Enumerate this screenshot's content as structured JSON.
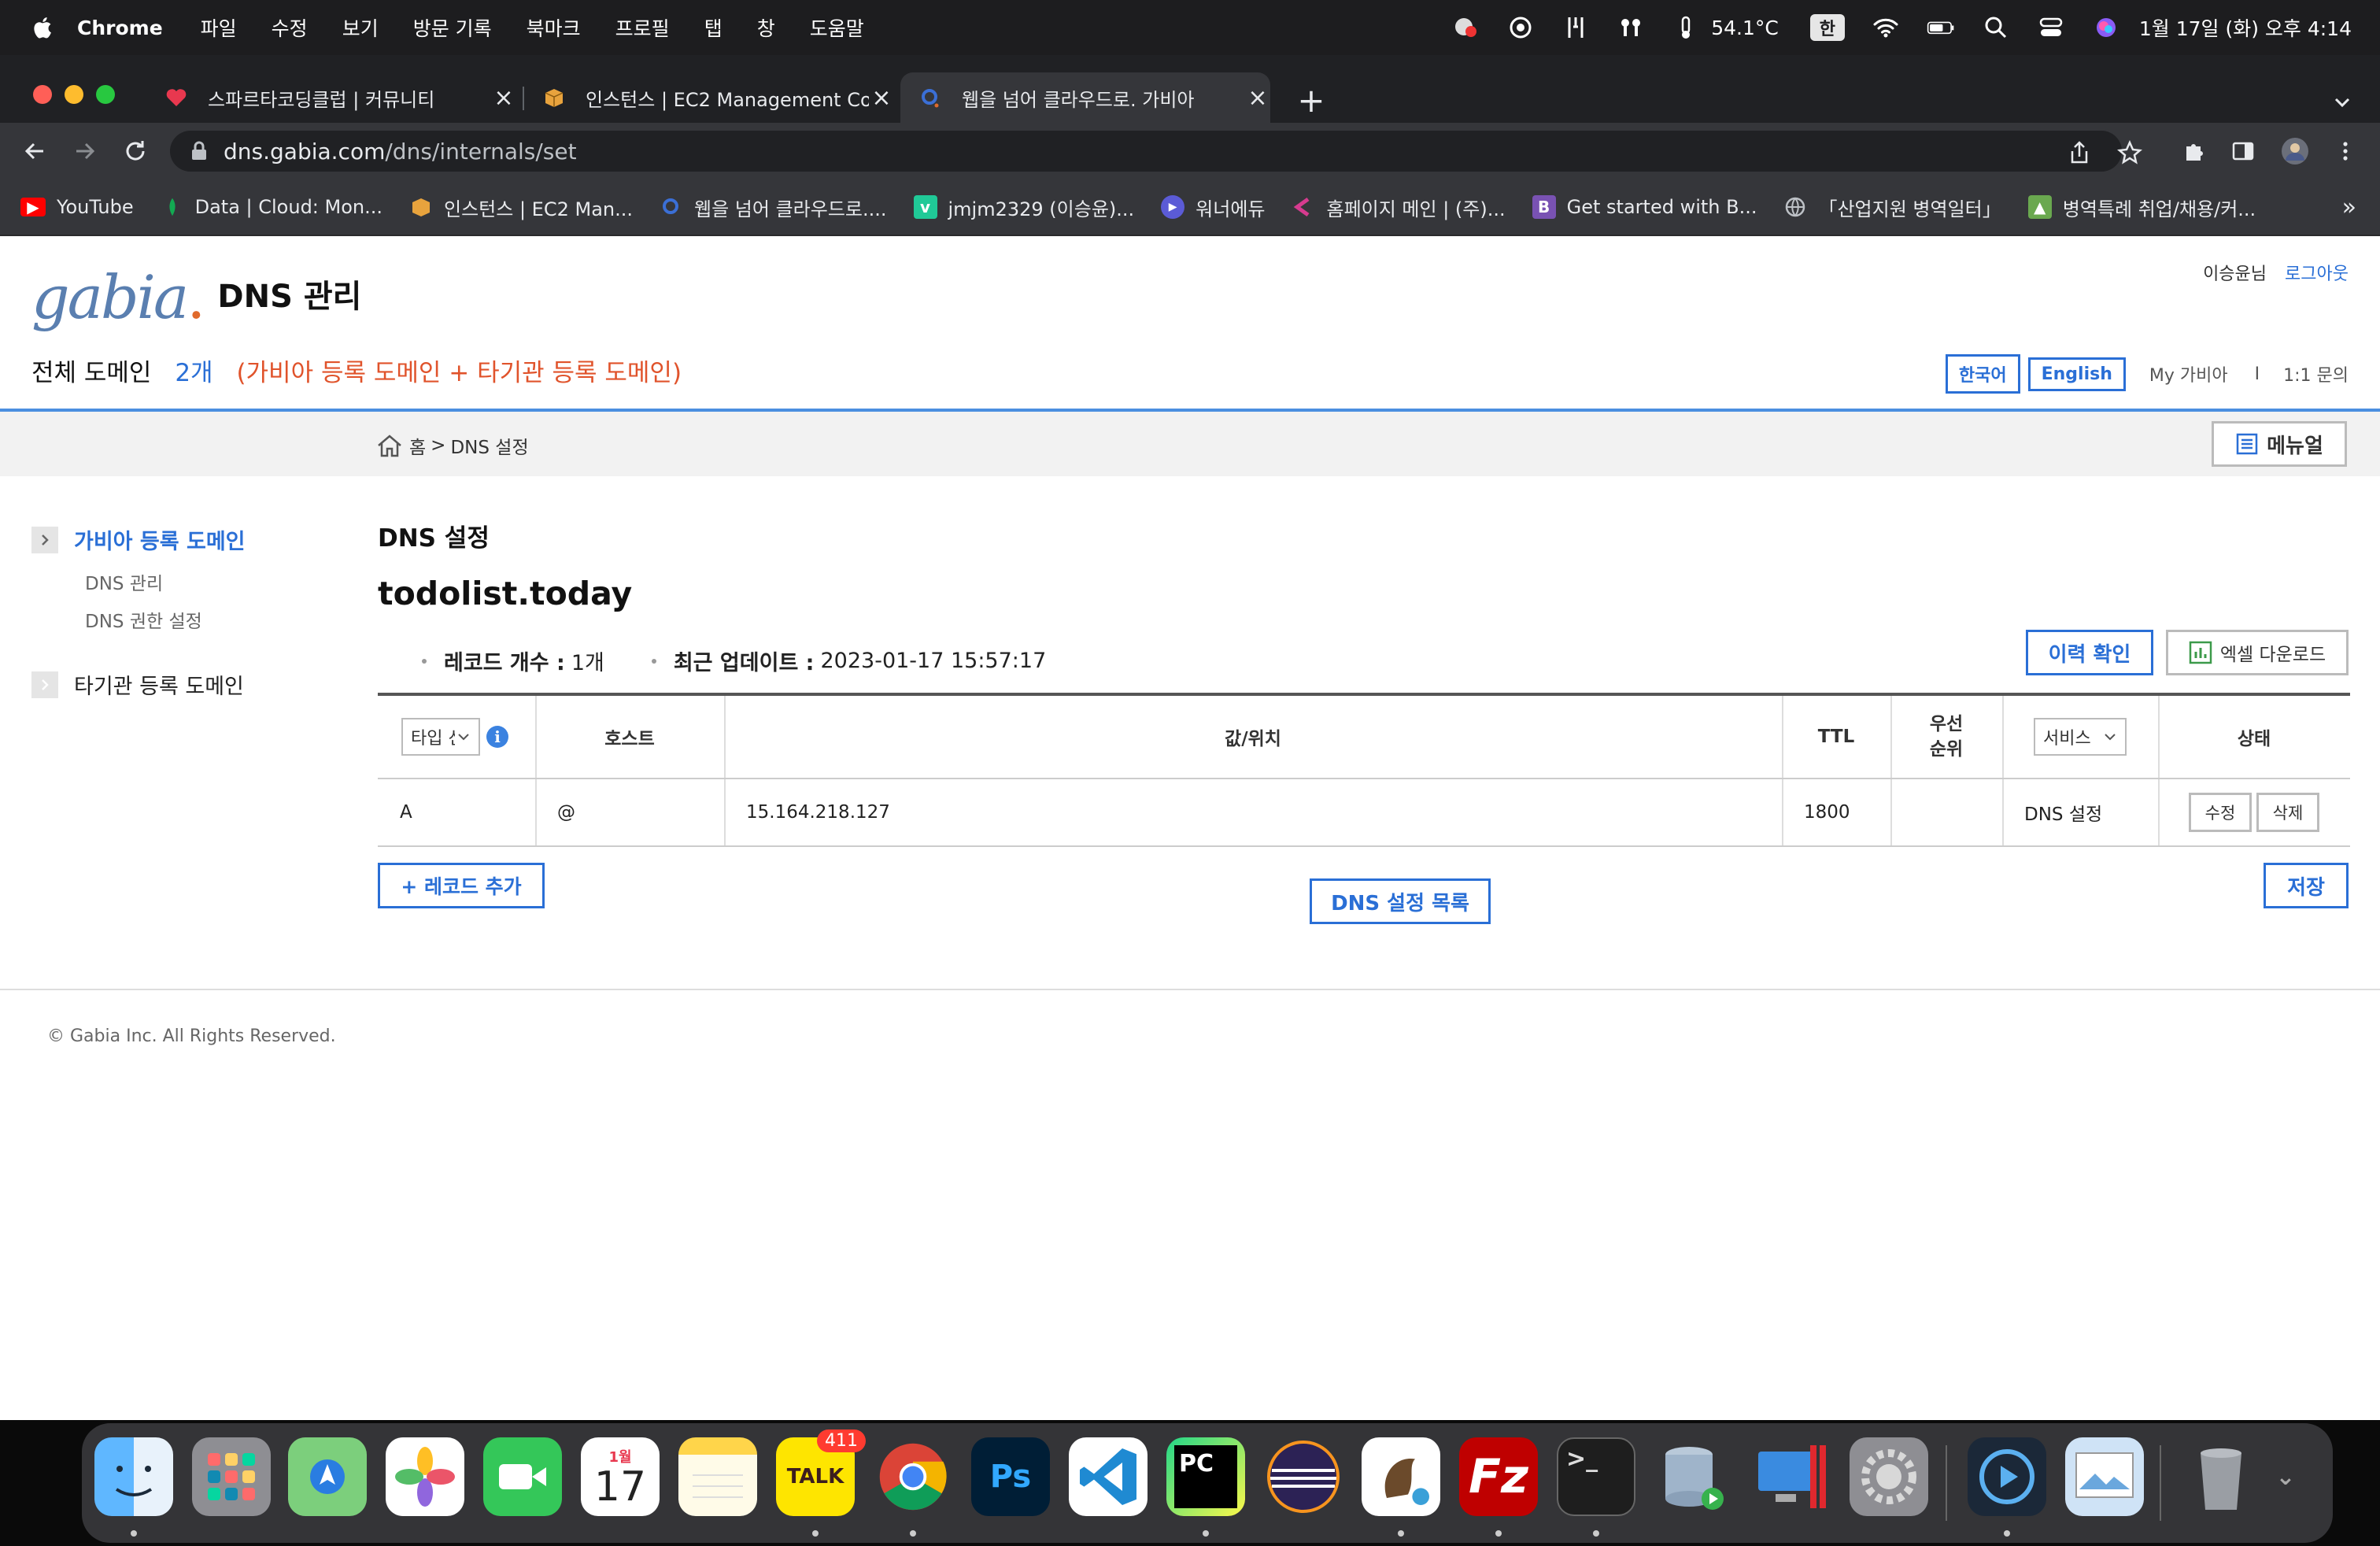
{
  "menubar": {
    "app": "Chrome",
    "items": [
      "파일",
      "수정",
      "보기",
      "방문 기록",
      "북마크",
      "프로필",
      "탭",
      "창",
      "도움말"
    ],
    "temperature": "54.1°C",
    "input_source": "한",
    "datetime": "1월 17일 (화) 오후 4:14"
  },
  "tabs": [
    {
      "title": "스파르타코딩클럽 | 커뮤니티",
      "icon": "sparta-heart-icon",
      "color": "#e8384f"
    },
    {
      "title": "인스턴스 | EC2 Management Cor",
      "icon": "aws-box-icon",
      "color": "#e8a33d"
    },
    {
      "title": "웹을 넘어 클라우드로. 가비아",
      "icon": "gabia-g-icon",
      "color": "#3b6fd6"
    }
  ],
  "address": {
    "host": "dns.gabia.com",
    "path": "/dns/internals/set"
  },
  "bookmarks": [
    {
      "label": "YouTube",
      "icon": "youtube-icon",
      "color": "#ff0000"
    },
    {
      "label": "Data | Cloud: Mon...",
      "icon": "mongodb-leaf-icon",
      "color": "#13aa52"
    },
    {
      "label": "인스턴스 | EC2 Man...",
      "icon": "aws-box-icon",
      "color": "#e8a33d"
    },
    {
      "label": "웹을 넘어 클라우드로....",
      "icon": "gabia-g-icon",
      "color": "#3b6fd6"
    },
    {
      "label": "jmjm2329 (이승윤)...",
      "icon": "velog-v-icon",
      "color": "#20c997"
    },
    {
      "label": "워너에듀",
      "icon": "play-circle-icon",
      "color": "#5b5bd6"
    },
    {
      "label": "홈페이지 메인 | (주)...",
      "icon": "homepage-icon",
      "color": "#d63b8f"
    },
    {
      "label": "Get started with B...",
      "icon": "bootstrap-b-icon",
      "color": "#7952b3"
    },
    {
      "label": "「산업지원 병역일터」",
      "icon": "globe-icon",
      "color": "#bdc1c6"
    },
    {
      "label": "병역특례 취업/채용/커...",
      "icon": "job-icon",
      "color": "#6aa84f"
    }
  ],
  "header": {
    "logo_text": "gabia",
    "title": "DNS 관리",
    "user": "이승윤님",
    "logout": "로그아웃",
    "all_domains": "전체 도메인",
    "domain_count": "2개",
    "domain_breakdown": "(가비아 등록 도메인 + 타기관 등록 도메인)",
    "lang_ko": "한국어",
    "lang_en": "English",
    "my_gabia": "My 가비아",
    "separator": "I",
    "inquiry": "1:1 문의"
  },
  "breadcrumb": {
    "home": "홈",
    "sep": ">",
    "current": "DNS 설정",
    "manual": "메뉴얼"
  },
  "sidebar": {
    "sections": [
      {
        "label": "가비아 등록 도메인",
        "active": true,
        "items": [
          "DNS 관리",
          "DNS 권한 설정"
        ]
      },
      {
        "label": "타기관 등록 도메인",
        "active": false,
        "items": []
      }
    ]
  },
  "main": {
    "title": "DNS 설정",
    "domain": "todolist.today",
    "record_count_label": "레코드 개수 :",
    "record_count": "1개",
    "last_update_label": "최근 업데이트 :",
    "last_update": "2023-01-17 15:57:17",
    "history_button": "이력 확인",
    "excel_button": "엑셀 다운로드",
    "add_record_button": "+ 레코드 추가",
    "dns_list_button": "DNS 설정 목록",
    "save_button": "저장"
  },
  "table": {
    "headers": {
      "type_select": "타입 선택",
      "host": "호스트",
      "value": "값/위치",
      "ttl": "TTL",
      "priority": "우선\n순위",
      "service_select": "서비스",
      "status": "상태"
    },
    "rows": [
      {
        "type": "A",
        "host": "@",
        "value": "15.164.218.127",
        "ttl": "1800",
        "priority": "",
        "service": "DNS 설정",
        "edit": "수정",
        "delete": "삭제"
      }
    ]
  },
  "footer": {
    "copyright": "© Gabia Inc. All Rights Reserved."
  },
  "dock": {
    "kakaotalk_badge": "411",
    "calendar_month": "1월",
    "calendar_day": "17",
    "apps": [
      "finder",
      "launchpad",
      "maps",
      "photos",
      "facetime",
      "calendar",
      "notes",
      "kakaotalk",
      "chrome",
      "photoshop",
      "vscode",
      "pycharm",
      "eclipse",
      "dbeaver",
      "filezilla",
      "terminal",
      "sequel",
      "parallels",
      "system-preferences",
      "quicktime",
      "preview",
      "trash"
    ]
  }
}
